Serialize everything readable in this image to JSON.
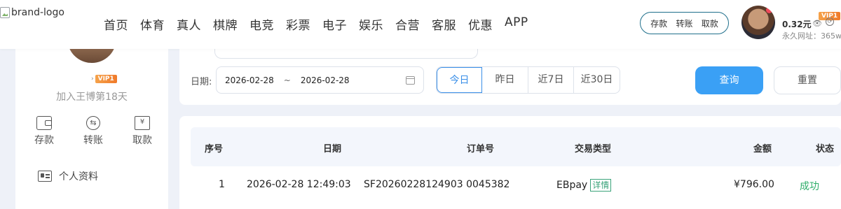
{
  "brand": {
    "logo_alt": "brand-logo"
  },
  "nav": [
    "首页",
    "体育",
    "真人",
    "棋牌",
    "电竞",
    "彩票",
    "电子",
    "娱乐",
    "合营",
    "客服",
    "优惠",
    "APP"
  ],
  "quick_actions": {
    "deposit": "存款",
    "transfer": "转账",
    "withdraw": "取款"
  },
  "user": {
    "vip_label": "VIP1",
    "balance": "0.32元",
    "site_url": "永久网址：365w",
    "eye_icon": "eye-icon",
    "refresh_icon": "refresh-icon"
  },
  "sidebar": {
    "vip_label": "VIP1",
    "join_text": "加入王博第18天",
    "actions": [
      {
        "label": "存款",
        "icon": "wallet-icon"
      },
      {
        "label": "转账",
        "icon": "transfer-icon"
      },
      {
        "label": "取款",
        "icon": "withdraw-icon"
      }
    ],
    "profile_label": "个人资料"
  },
  "filter": {
    "date_label": "日期:",
    "start_date": "2026-02-28",
    "range_sep": "~",
    "end_date": "2026-02-28",
    "quick_dates": [
      "今日",
      "昨日",
      "近7日",
      "近30日"
    ],
    "active_quick": "今日",
    "query_label": "查询",
    "reset_label": "重置"
  },
  "table": {
    "headers": [
      "序号",
      "日期",
      "订单号",
      "交易类型",
      "金额",
      "状态"
    ],
    "rows": [
      {
        "index": "1",
        "date": "2026-02-28 12:49:03",
        "order_no": "SF20260228124903 0045382",
        "type": "EBpay",
        "detail": "详情",
        "amount": "¥796.00",
        "status": "成功"
      }
    ]
  },
  "colors": {
    "accent": "#3aa0f5",
    "success": "#2fae6a",
    "background": "#eef1f8"
  }
}
